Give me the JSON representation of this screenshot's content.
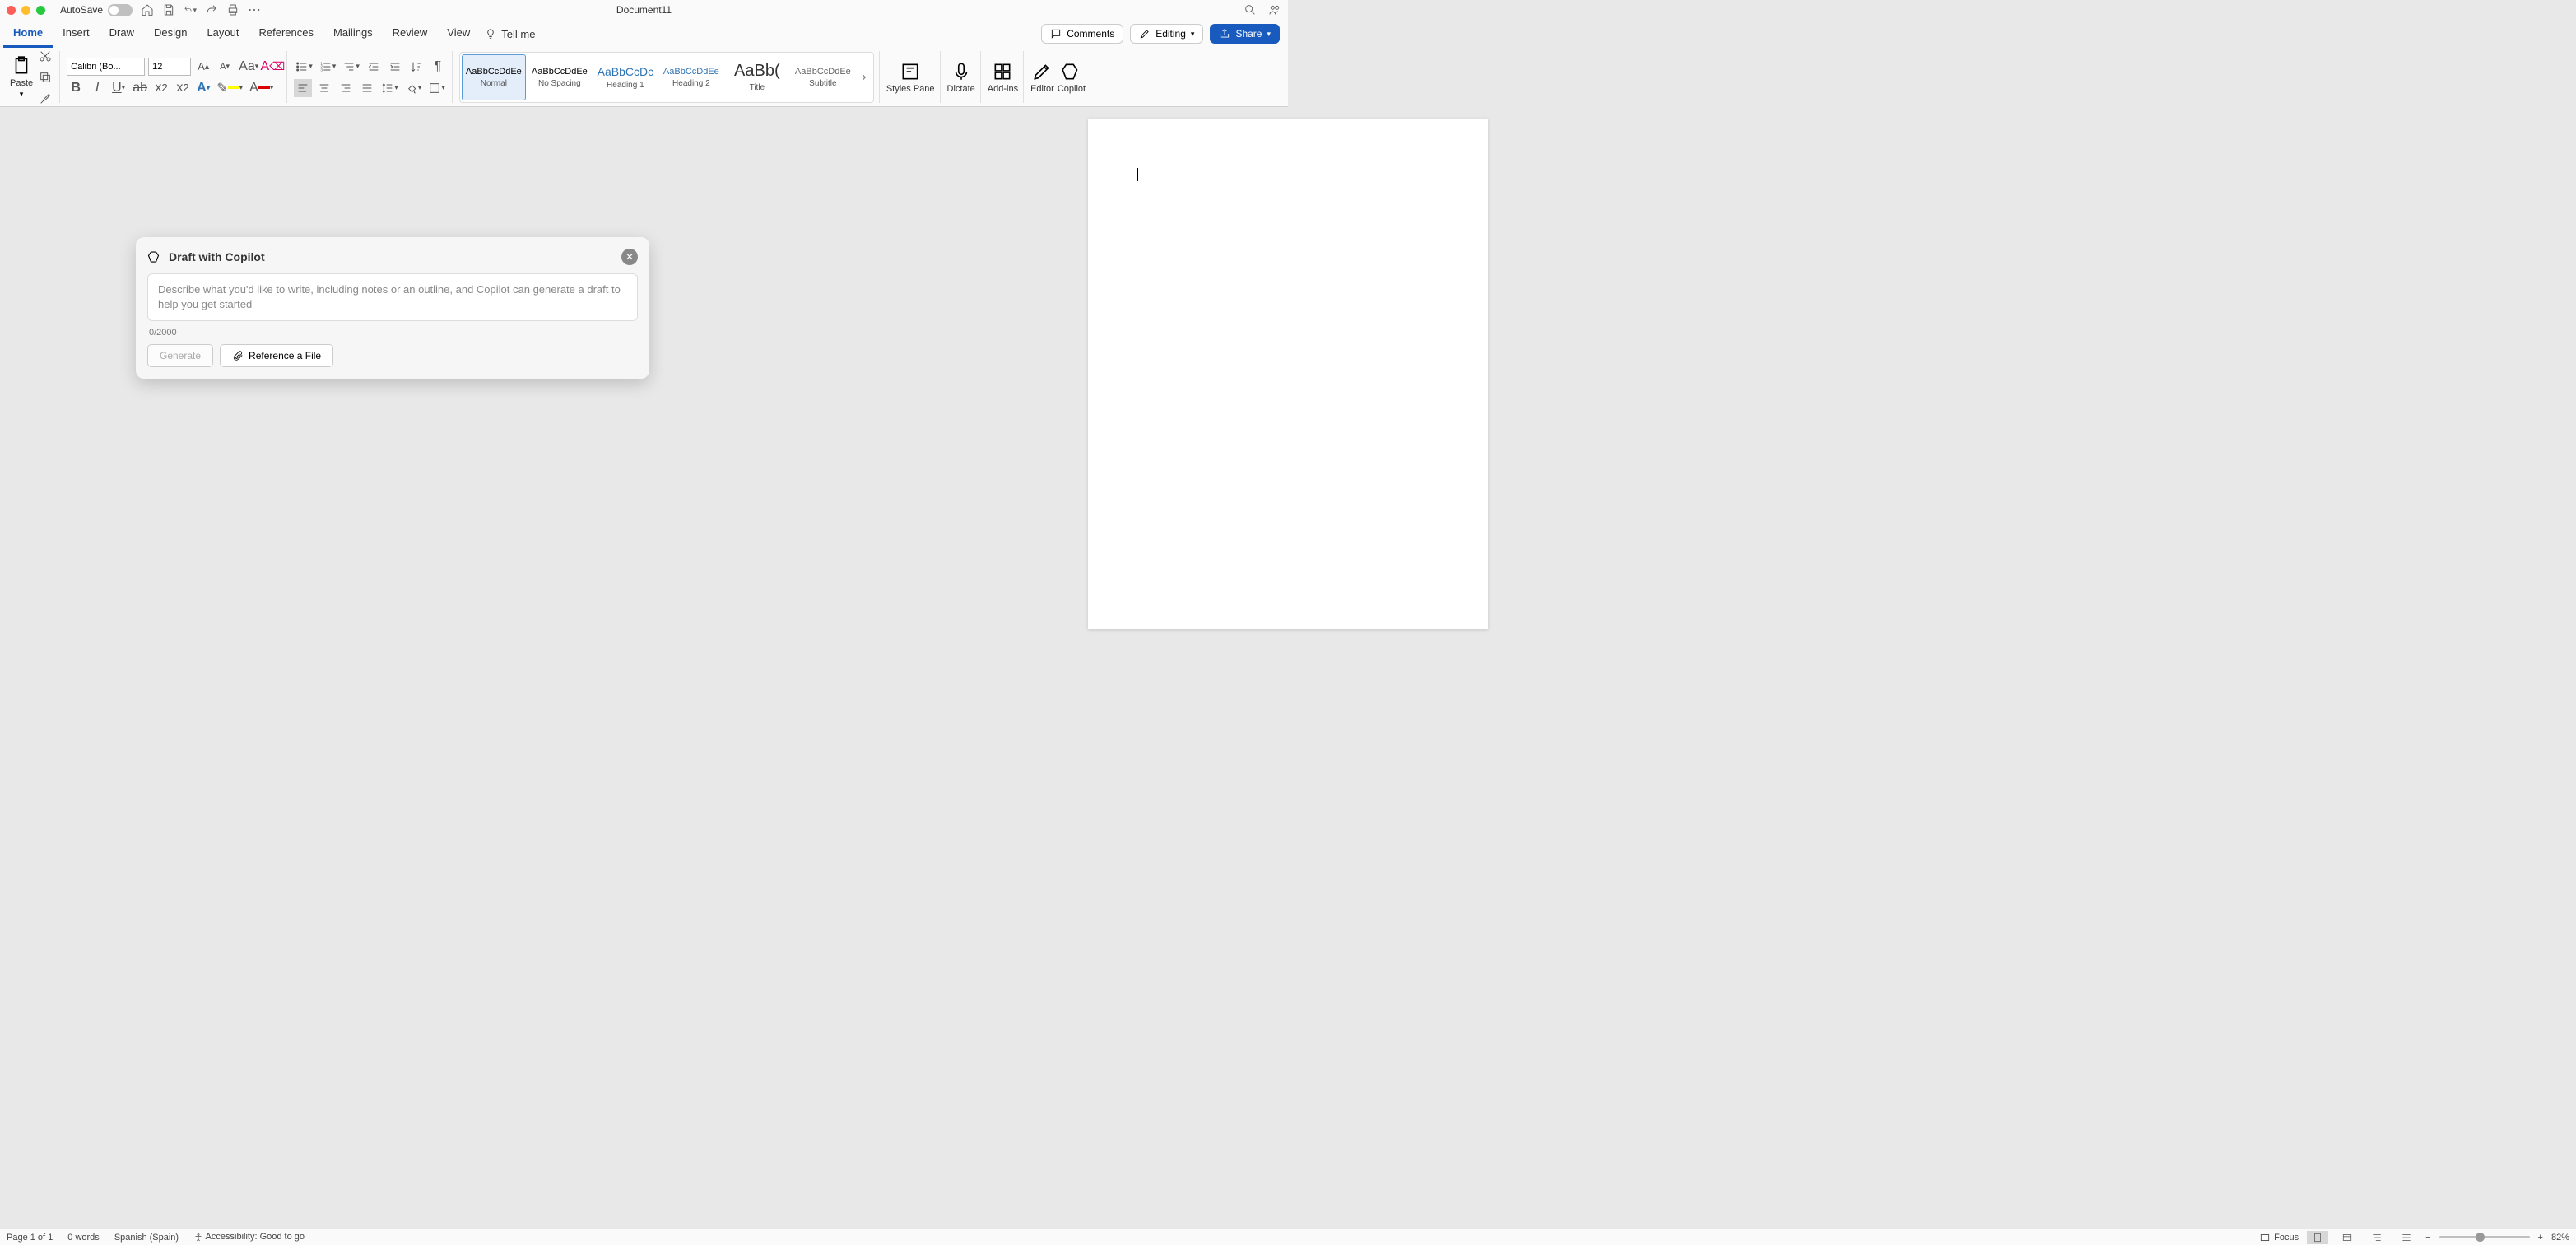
{
  "titlebar": {
    "autosave_label": "AutoSave",
    "doc_title": "Document11"
  },
  "tabs": {
    "items": [
      "Home",
      "Insert",
      "Draw",
      "Design",
      "Layout",
      "References",
      "Mailings",
      "Review",
      "View"
    ],
    "active_index": 0,
    "tellme": "Tell me",
    "comments": "Comments",
    "editing": "Editing",
    "share": "Share"
  },
  "ribbon": {
    "paste_label": "Paste",
    "font_name": "Calibri (Bo...",
    "font_size": "12",
    "styles": [
      {
        "preview": "AaBbCcDdEe",
        "name": "Normal",
        "cls": ""
      },
      {
        "preview": "AaBbCcDdEe",
        "name": "No Spacing",
        "cls": ""
      },
      {
        "preview": "AaBbCcDc",
        "name": "Heading 1",
        "cls": "h1"
      },
      {
        "preview": "AaBbCcDdEe",
        "name": "Heading 2",
        "cls": "h2"
      },
      {
        "preview": "AaBb(",
        "name": "Title",
        "cls": "title"
      },
      {
        "preview": "AaBbCcDdEe",
        "name": "Subtitle",
        "cls": "sub"
      }
    ],
    "styles_pane": "Styles Pane",
    "dictate": "Dictate",
    "addins": "Add-ins",
    "editor": "Editor",
    "copilot": "Copilot"
  },
  "copilot": {
    "title": "Draft with Copilot",
    "placeholder": "Describe what you'd like to write, including notes or an outline, and Copilot can generate a draft to help you get started",
    "count": "0/2000",
    "generate": "Generate",
    "reference": "Reference a File"
  },
  "status": {
    "page": "Page 1 of 1",
    "words": "0 words",
    "lang": "Spanish (Spain)",
    "access": "Accessibility: Good to go",
    "focus": "Focus",
    "zoom": "82%"
  }
}
